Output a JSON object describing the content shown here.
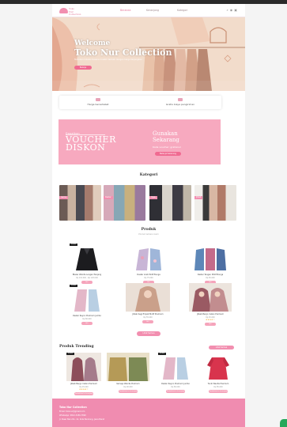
{
  "nav": {
    "brand_line1": "Toko",
    "brand_line2": "Nur Collection",
    "links": [
      "Beranda",
      "Keranjang",
      "Kategori"
    ],
    "icons": [
      "search-icon",
      "user-icon",
      "cart-icon"
    ]
  },
  "hero": {
    "welcome": "Welcome",
    "title": "Toko Nur Collection",
    "subtitle": "Temukan koleksi busana muslim terbaik dengan harga terjangkau",
    "button": "Belanja"
  },
  "features": [
    {
      "icon": "shop-icon",
      "label": "Harga bersahabat"
    },
    {
      "icon": "delivery-icon",
      "label": "Gratis biaya pengiriman"
    }
  ],
  "voucher": {
    "small": "Dapatkan",
    "big1": "VOUCHER",
    "big2": "DISKON",
    "r1": "Gunakan",
    "r2": "Sekarang",
    "r3": "Kode voucher: gratisnur",
    "button": "Belanja Sekarang"
  },
  "kategori": {
    "title": "Kategori",
    "items": [
      "Gamis",
      "Daster",
      "Hijab",
      "Jilbab"
    ]
  },
  "produk": {
    "title": "Produk",
    "subtitle": "Produk terbaru kami",
    "more": "Lihat Semua",
    "items": [
      {
        "tag": "Terlaris",
        "name": "Blazer Wanita Lengan Panjang",
        "price": "Rp 110.000 - Rp 120.000",
        "button": "Beli"
      },
      {
        "tag": "",
        "name": "Daster Arab Motif Bunga",
        "price": "Rp 75.000",
        "button": "Beli"
      },
      {
        "tag": "",
        "name": "Daster Tangan Motif Bunga",
        "price": "Rp 65.000",
        "button": "Beli"
      },
      {
        "tag": "Terlaris",
        "name": "Daster Rayon Premium Jumbo",
        "price": "Rp 80.000",
        "button": "Beli"
      },
      {
        "tag": "",
        "name": "Jilbab Segi Empat Motif Premium",
        "price": "Rp 55.000",
        "button": "Beli"
      },
      {
        "tag": "",
        "name": "Jilbab Bergo Instan Premium",
        "price": "Rp 45.000",
        "button": "Beli"
      }
    ]
  },
  "trending": {
    "title": "Produk Trending",
    "button": "Lihat Semua",
    "items": [
      {
        "tag": "Terlaris",
        "name": "Jilbab Bergo Instan Premium",
        "price": "Rp 45.000",
        "button": "Tambahkan ke keranjang"
      },
      {
        "tag": "",
        "name": "Kemeja Wanita Premium",
        "price": "Rp 90.000",
        "button": "Tambahkan ke keranjang"
      },
      {
        "tag": "Terlaris",
        "name": "Daster Rayon Premium Jumbo",
        "price": "Rp 80.000",
        "button": "Tambahkan ke keranjang"
      },
      {
        "tag": "",
        "name": "Tunik Wanita Premium",
        "price": "Rp 85.000",
        "button": "Tambahkan ke keranjang"
      }
    ]
  },
  "footer": {
    "brand": "Toko Nur Collection",
    "l1": "Email: tokonur@gmail.com",
    "l2": "WhatsApp: 0812-3456-7890",
    "l3": "Jl. Pasar Baru No. 12, Kota Bandung, Jawa Barat"
  },
  "colors": {
    "accent": "#f28fb0",
    "button": "#f06a91",
    "voucher_bg": "#f7a9bf",
    "footer": "#f08cb0",
    "chat": "#25a85a"
  }
}
